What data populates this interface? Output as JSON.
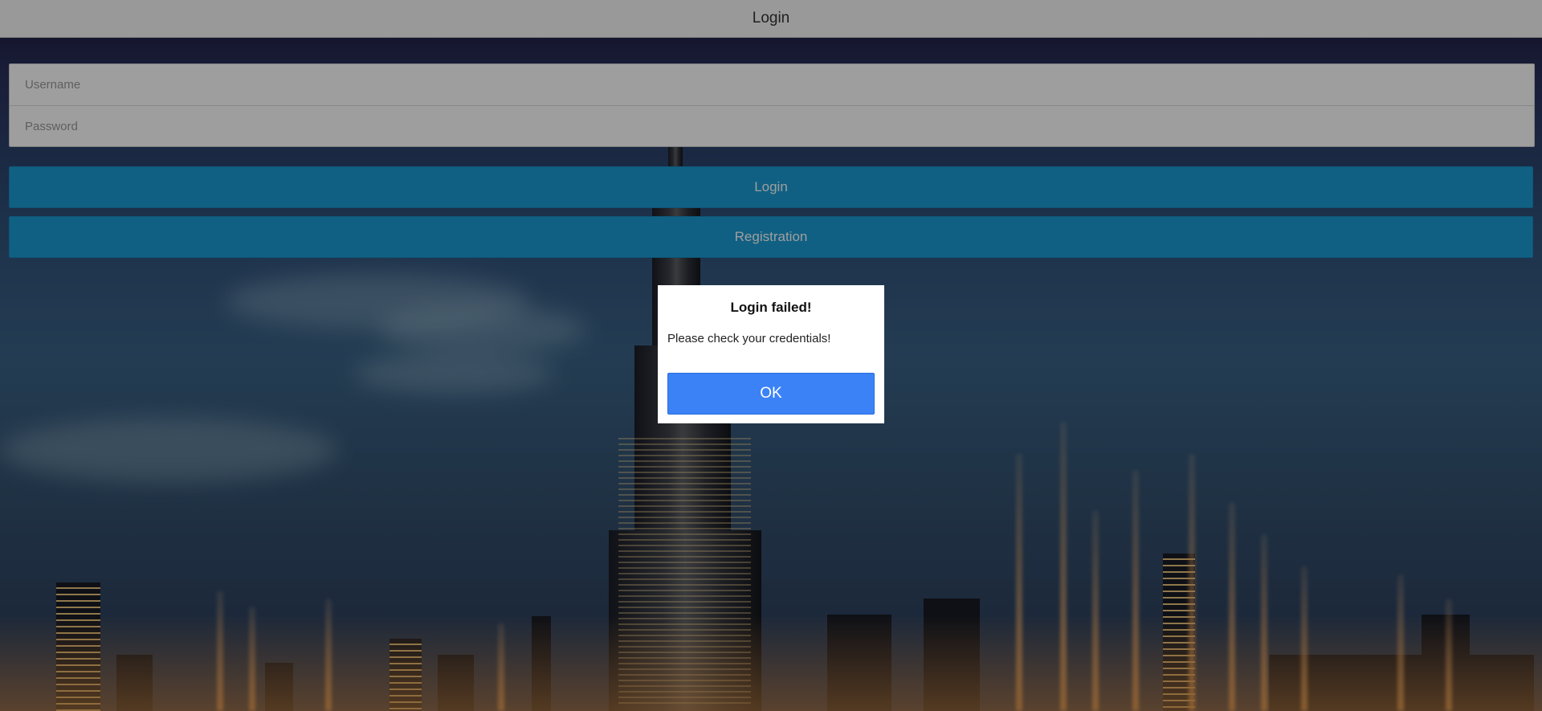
{
  "header": {
    "title": "Login"
  },
  "form": {
    "username_placeholder": "Username",
    "password_placeholder": "Password",
    "username_value": "",
    "password_value": ""
  },
  "buttons": {
    "login_label": "Login",
    "registration_label": "Registration"
  },
  "dialog": {
    "title": "Login failed!",
    "message": "Please check your credentials!",
    "ok_label": "OK"
  },
  "colors": {
    "primary_button": "#1a9bd4",
    "dialog_button": "#3b82f6",
    "topbar": "#f7f7f7"
  }
}
